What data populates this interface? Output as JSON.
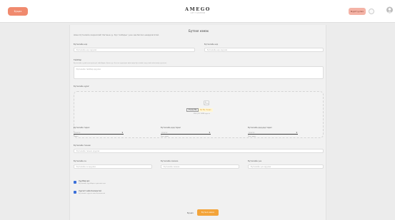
{
  "header": {
    "back_label": "Буцах",
    "logo": "AMEGO",
    "logo_sub": "АРТ ГАЛЛЕРИ",
    "register_label": "Бүртгүүлэх"
  },
  "form": {
    "title": "Бүтээл нэмэх",
    "subtitle": "Шинэ бүтээлийн мэдээллийг бөглөнө үү. Бүх талбарыг үнэн зөв бөглөх шаардлагатай.",
    "title_mn": {
      "label": "Бүтээлийн нэр",
      "placeholder": "Бүтээлийн нэр оруулах"
    },
    "title_en": {
      "label": "Бүтээлийн нэр",
      "placeholder": "Бүтээлийн нэр оруулах"
    },
    "description": {
      "label": "Тайлбар",
      "hint": "Бүтээлийн тухай дэлгэрэнгүй тайлбарыг бичнэ үү. Энэ нь худалдан авагчдад бүтээлийг илүү сайн ойлгоход тусална.",
      "placeholder": "Бүтээлийн тайлбар оруулах"
    },
    "image": {
      "label": "Бүтээлийн зураг",
      "choose_button": "Choose file",
      "no_file": "No file chosen",
      "note": "PNG, JPG 10MB хүртэл"
    },
    "type": {
      "label": "Бүтээлийн төрөл",
      "placeholder": "Сонгох",
      "note": "Төрөл"
    },
    "genre": {
      "label": "Бүтээлийн дэд төрөл",
      "placeholder": "Сонгох",
      "note": "Дэд төрөл"
    },
    "subgenre": {
      "label": "Бүтээлийн дэд дэд төрөл",
      "placeholder": "Сонгох",
      "note": "Дэд төрөл"
    },
    "technique": {
      "label": "Бүтээлийн техник",
      "placeholder": "Бүтээлийн техник оруулах"
    },
    "year": {
      "label": "Бүтээлийн он",
      "placeholder": "Бүтээлийн он оруулах"
    },
    "size": {
      "label": "Бүтээлийн хэмжээ",
      "placeholder": "Бүтээлийн хэмжээ"
    },
    "price": {
      "label": "Бүтээлийн үнэ",
      "placeholder": "Бүтээлийн үнэ оруулах"
    },
    "check1": {
      "label": "Хуулбар эрх",
      "desc": "Бүтээлийн хуулбарыг худалдах эрх"
    },
    "check2": {
      "label": "Хүргэлт хийх боломжтой",
      "desc": "Бүтээлийг хүргэж өгөх боломжтой"
    },
    "back_label": "Буцах",
    "submit_label": "Бүтээл нэмэх"
  },
  "colors": {
    "accent": "#f3a43a",
    "back_button": "#f08a6e",
    "register_button": "#f4b3a6",
    "checkbox": "#3a6fd8"
  }
}
